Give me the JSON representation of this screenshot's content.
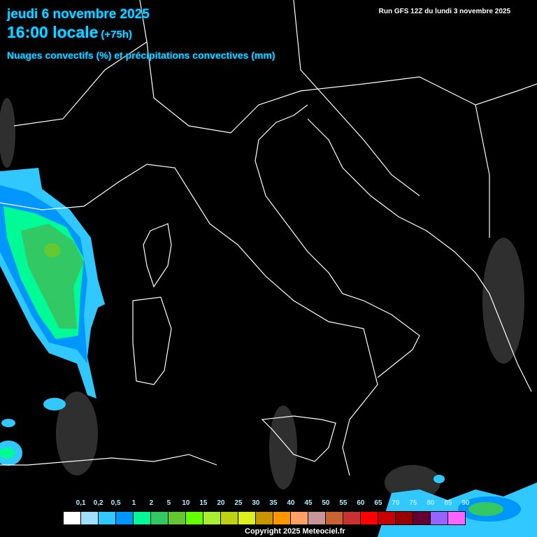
{
  "header": {
    "date": "jeudi 6 novembre 2025",
    "time": "16:00 locale",
    "lead": "(+75h)",
    "parameter": "Nuages convectifs (%) et précipitations convectives (mm)",
    "run": "Run GFS 12Z du lundi 3 novembre 2025"
  },
  "legend": {
    "labels": [
      "0,1",
      "0,2",
      "0,5",
      "1",
      "2",
      "5",
      "10",
      "15",
      "20",
      "25",
      "30",
      "35",
      "40",
      "45",
      "50",
      "55",
      "60",
      "65",
      "70",
      "75",
      "80",
      "85",
      "90"
    ],
    "colors": [
      "#ffffff",
      "#a0e0ff",
      "#30c8ff",
      "#0096ff",
      "#00fa96",
      "#32c864",
      "#64c832",
      "#64ff00",
      "#aaf032",
      "#bed214",
      "#dcf01e",
      "#c89600",
      "#ff9600",
      "#ffa064",
      "#c89696",
      "#c86432",
      "#c83232",
      "#ff0000",
      "#c80000",
      "#960000",
      "#640032",
      "#9664ff",
      "#ff64ff"
    ]
  },
  "copyright": "Copyright 2025 Meteociel.fr"
}
